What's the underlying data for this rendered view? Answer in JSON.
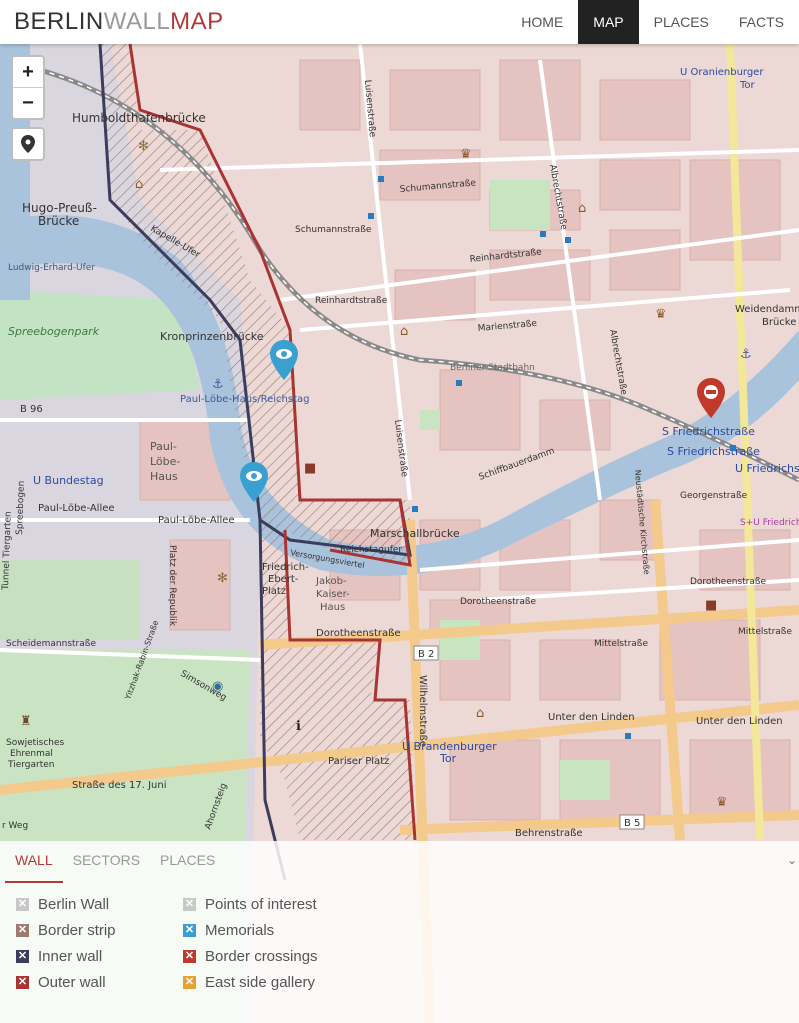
{
  "brand": {
    "part1": "BERLIN",
    "part2": "WALL",
    "part3": "MAP"
  },
  "nav": {
    "home": "HOME",
    "map": "MAP",
    "places": "PLACES",
    "facts": "FACTS"
  },
  "map": {
    "controls": {
      "zoom_in": "+",
      "zoom_out": "−"
    },
    "labels": {
      "humboldthafenbrucke": "Humboldthafenbrücke",
      "hugo_preuss": "Hugo-Preuß-",
      "brucke": "Brücke",
      "ludwig_erhard": "Ludwig-Erhard-Ufer",
      "spreebogenpark": "Spreebogenpark",
      "kronprinzenbrucke": "Kronprinzenbrücke",
      "b96": "B 96",
      "paul_lobe_haus_reichstag": "Paul-Löbe-Haus/Reichstag",
      "paul": "Paul-",
      "lobe": "Löbe-",
      "haus": "Haus",
      "u_bundestag": "U Bundestag",
      "paul_lobe_allee": "Paul-Löbe-Allee",
      "platz_der_republik": "Platz der Republik",
      "fried1": "Friedrich-",
      "fried2": "Ebert-",
      "fried3": "Platz",
      "jakob1": "Jakob-",
      "jakob2": "Kaiser-",
      "jakob3": "Haus",
      "scheidemannstrasse": "Scheidemannstraße",
      "dorotheenstrasse": "Dorotheenstraße",
      "b2": "B 2",
      "wilhelmstrasse": "Wilhelmstraße",
      "simsonweg": "Simsonweg",
      "sowj1": "Sowjetisches",
      "sowj2": "Ehrenmal",
      "sowj3": "Tiergarten",
      "strasse_17_juni": "Straße des 17. Juni",
      "pariser_platz": "Pariser Platz",
      "u_brandenburger_tor": "U Brandenburger",
      "tor": "Tor",
      "unter_den_linden": "Unter den Linden",
      "behrenstrasse": "Behrenstraße",
      "b5": "B 5",
      "marschallbrucke": "Marschallbrücke",
      "reichstagufer": "Reichstagufer",
      "schiffbauerdamm": "Schiffbauerdamm",
      "luisenstrasse": "Luisenstraße",
      "reinhardtstrasse": "Reinhardtstraße",
      "marienstrasse": "Marienstraße",
      "schumannstrasse": "Schumannstraße",
      "albrechtstrasse": "Albrechtstraße",
      "s_friedrichstrasse": "S Friedrichstraße",
      "u_friedrichstrasse": "U Friedrichstraße",
      "georgenstrasse": "Georgenstraße",
      "mittelstrasse": "Mittelstraße",
      "su_friedrich": "S+U Friedrich",
      "weidendammer": "Weidendammer",
      "u_oranienburger_tor": "U Oranienburger",
      "berliner_stadtbahn": "Berliner Stadtbahn",
      "kapelle_ufer": "Kapelle-Ufer",
      "neustaedtische": "Neustädtische Kirchstraße",
      "versorgung": "Versorgungsviertel",
      "ahornsteig": "Ahornsteig",
      "yitzhak": "Yitzhak-Rabin-Straße",
      "rb_weg": "r Weg",
      "spreebogen": "Spreebogen",
      "tiergarten_tunnel": "Tunnel Tiergarten",
      "albrechtstr2": "Albrechtstraße"
    }
  },
  "panel": {
    "tabs": [
      "WALL",
      "SECTORS",
      "PLACES"
    ],
    "legend_left": [
      {
        "label": "Berlin Wall",
        "color": "#c8c8c8"
      },
      {
        "label": "Border strip",
        "color": "#a07a70"
      },
      {
        "label": "Inner wall",
        "color": "#3c3c5c"
      },
      {
        "label": "Outer wall",
        "color": "#a83434"
      }
    ],
    "legend_right": [
      {
        "label": "Points of interest",
        "color": "#c8c8c8"
      },
      {
        "label": "Memorials",
        "color": "#3aa0d0"
      },
      {
        "label": "Border crossings",
        "color": "#c0392b"
      },
      {
        "label": "East side gallery",
        "color": "#e8a030"
      }
    ]
  },
  "colors": {
    "accent": "#b03a3a",
    "marker_blue": "#3aa0d0",
    "marker_red": "#c0392b"
  }
}
